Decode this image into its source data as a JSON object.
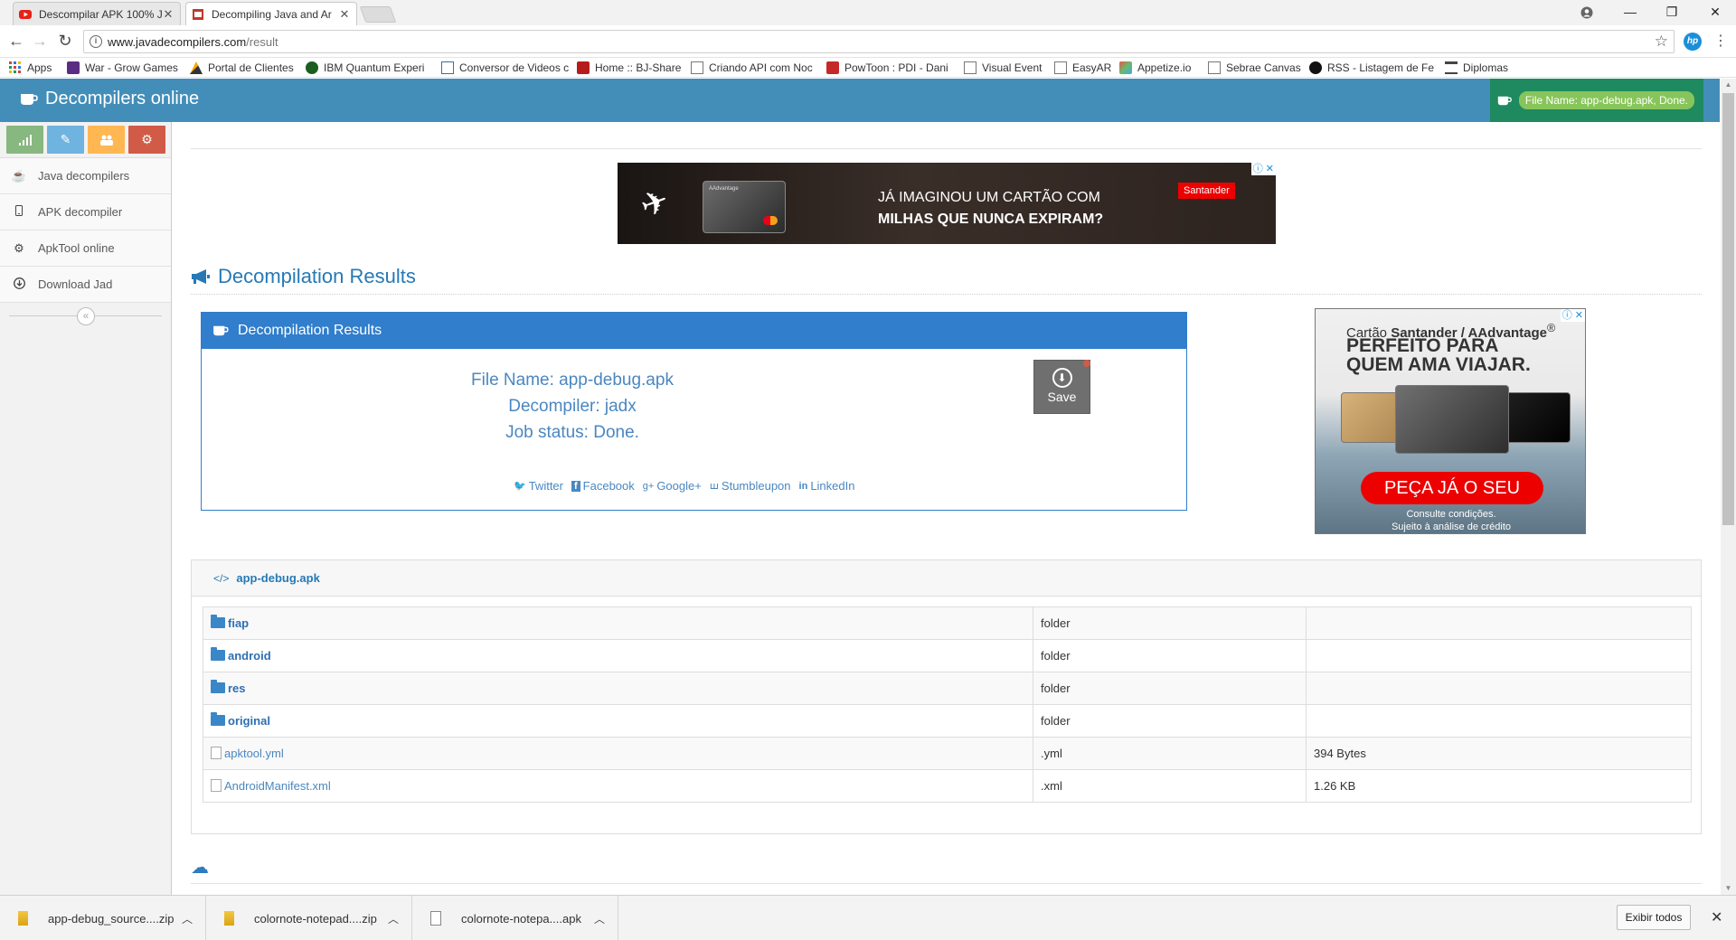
{
  "browser": {
    "tabs": [
      {
        "title": "Descompilar APK 100% J",
        "favicon": "youtube-icon"
      },
      {
        "title": "Decompiling Java and Ar",
        "favicon": "javadecompilers-icon"
      }
    ],
    "url_host": "www.javadecompilers.com",
    "url_path": "/result",
    "bookmarks": [
      {
        "label": "Apps",
        "icon": "apps-grid-icon"
      },
      {
        "label": "War - Grow Games",
        "icon": "game-icon"
      },
      {
        "label": "Portal de Clientes",
        "icon": "portal-icon"
      },
      {
        "label": "IBM Quantum Experi",
        "icon": "ibm-icon"
      },
      {
        "label": "Conversor de Videos c",
        "icon": "converter-icon"
      },
      {
        "label": "Home :: BJ-Share",
        "icon": "bj-icon"
      },
      {
        "label": "Criando API com Noc",
        "icon": "page-icon"
      },
      {
        "label": "PowToon : PDI - Dani",
        "icon": "powtoon-icon"
      },
      {
        "label": "Visual Event",
        "icon": "page-icon"
      },
      {
        "label": "EasyAR",
        "icon": "page-icon"
      },
      {
        "label": "Appetize.io",
        "icon": "appetize-icon"
      },
      {
        "label": "Sebrae Canvas",
        "icon": "page-icon"
      },
      {
        "label": "RSS - Listagem de Fe",
        "icon": "rss-icon"
      },
      {
        "label": "Diplomas",
        "icon": "bank-icon"
      }
    ]
  },
  "header": {
    "brand": "Decompilers online",
    "notification": "File Name: app-debug.apk, Done."
  },
  "sidebar": {
    "shortcut_colors": [
      "#87b87f",
      "#6fb3e0",
      "#ffb752",
      "#d15b47"
    ],
    "items": [
      {
        "label": "Java decompilers",
        "icon": "coffee-icon"
      },
      {
        "label": "APK decompiler",
        "icon": "mobile-icon"
      },
      {
        "label": "ApkTool online",
        "icon": "gear-icon"
      },
      {
        "label": "Download Jad",
        "icon": "download-icon"
      }
    ]
  },
  "ads": {
    "top": {
      "line1": "JÁ IMAGINOU UM CARTÃO COM",
      "line2": "MILHAS QUE NUNCA EXPIRAM?",
      "brand": "Santander",
      "card_brand": "AAdvantage"
    },
    "side": {
      "line1_a": "Cartão ",
      "line1_b": "Santander / AAdvantage",
      "reg": "®",
      "line2": "PERFEITO PARA",
      "line3": "QUEM AMA VIAJAR.",
      "cta": "PEÇA JÁ O SEU",
      "fine1": "Consulte condições.",
      "fine2": "Sujeito à análise de crédito"
    }
  },
  "main": {
    "section_title": "Decompilation Results",
    "box_title": "Decompilation Results",
    "file_name": "File Name: app-debug.apk",
    "decompiler": "Decompiler: jadx",
    "job_status": "Job status: Done.",
    "save_label": "Save",
    "share": [
      "Twitter",
      "Facebook",
      "Google+",
      "Stumbleupon",
      "LinkedIn"
    ],
    "tree_root": "app-debug.apk",
    "files": [
      {
        "name": "fiap",
        "type": "folder",
        "size": "",
        "is_dir": true
      },
      {
        "name": "android",
        "type": "folder",
        "size": "",
        "is_dir": true
      },
      {
        "name": "res",
        "type": "folder",
        "size": "",
        "is_dir": true
      },
      {
        "name": "original",
        "type": "folder",
        "size": "",
        "is_dir": true
      },
      {
        "name": "apktool.yml",
        "type": ".yml",
        "size": "394 Bytes",
        "is_dir": false
      },
      {
        "name": "AndroidManifest.xml",
        "type": ".xml",
        "size": "1.26 KB",
        "is_dir": false
      }
    ]
  },
  "downloads": {
    "items": [
      {
        "name": "app-debug_source....zip",
        "kind": "zip"
      },
      {
        "name": "colornote-notepad....zip",
        "kind": "zip"
      },
      {
        "name": "colornote-notepa....apk",
        "kind": "apk"
      }
    ],
    "show_all": "Exibir todos"
  }
}
